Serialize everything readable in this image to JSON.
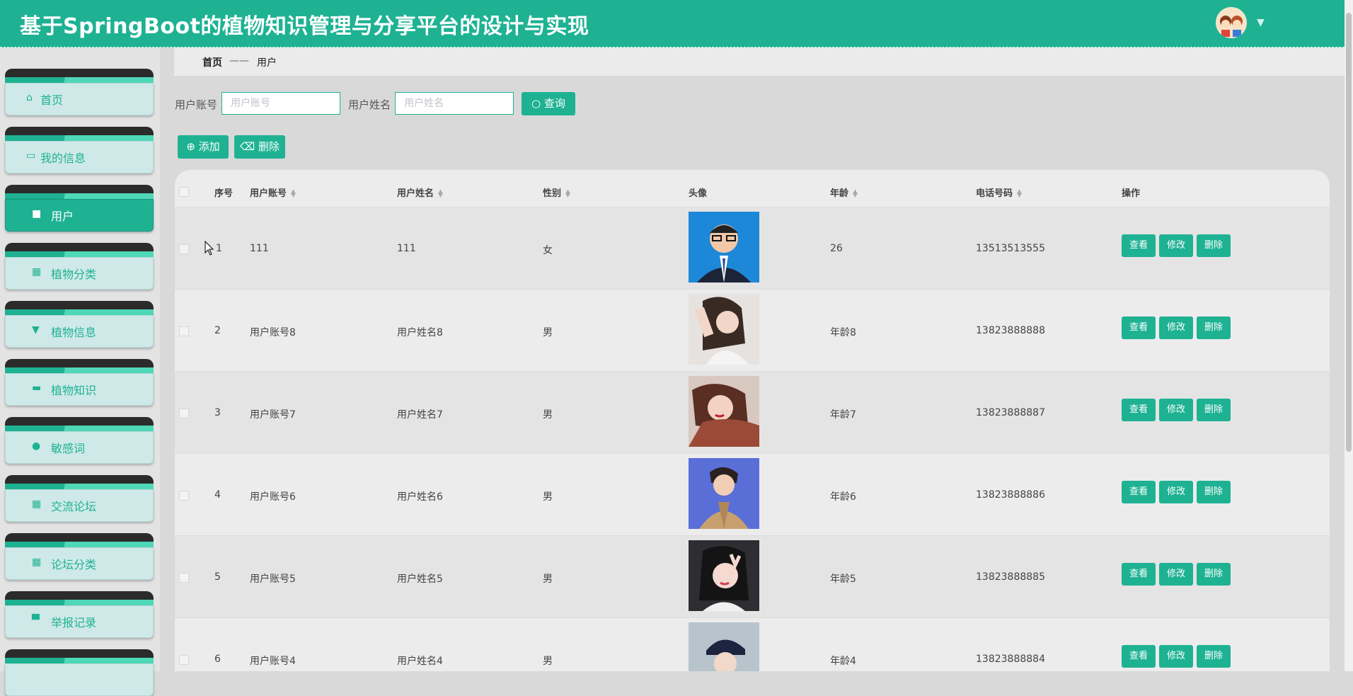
{
  "header": {
    "title": "基于SpringBoot的植物知识管理与分享平台的设计与实现"
  },
  "sidebar": {
    "items": [
      {
        "label": "首页",
        "icon": "home-icon"
      },
      {
        "label": "我的信息",
        "icon": "card-icon"
      },
      {
        "label": "用户",
        "icon": "briefcase-icon",
        "active": true
      },
      {
        "label": "植物分类",
        "icon": "grid-icon"
      },
      {
        "label": "植物信息",
        "icon": "sign-icon"
      },
      {
        "label": "植物知识",
        "icon": "book-icon"
      },
      {
        "label": "敏感词",
        "icon": "pin-icon"
      },
      {
        "label": "交流论坛",
        "icon": "grid-icon"
      },
      {
        "label": "论坛分类",
        "icon": "grid-icon"
      },
      {
        "label": "举报记录",
        "icon": "monitor-icon"
      }
    ]
  },
  "breadcrumb": {
    "home": "首页",
    "sep": "——",
    "current": "用户"
  },
  "search": {
    "account_label": "用户账号",
    "account_placeholder": "用户账号",
    "name_label": "用户姓名",
    "name_placeholder": "用户姓名",
    "query_label": "查询"
  },
  "toolbar": {
    "add_label": "添加",
    "delete_label": "删除"
  },
  "table": {
    "headers": {
      "index": "序号",
      "account": "用户账号",
      "name": "用户姓名",
      "gender": "性别",
      "avatar": "头像",
      "age": "年龄",
      "phone": "电话号码",
      "ops": "操作"
    },
    "actions": {
      "view": "查看",
      "edit": "修改",
      "delete": "删除"
    },
    "rows": [
      {
        "index": "1",
        "account": "111",
        "name": "111",
        "gender": "女",
        "age": "26",
        "phone": "13513513555"
      },
      {
        "index": "2",
        "account": "用户账号8",
        "name": "用户姓名8",
        "gender": "男",
        "age": "年龄8",
        "phone": "13823888888"
      },
      {
        "index": "3",
        "account": "用户账号7",
        "name": "用户姓名7",
        "gender": "男",
        "age": "年龄7",
        "phone": "13823888887"
      },
      {
        "index": "4",
        "account": "用户账号6",
        "name": "用户姓名6",
        "gender": "男",
        "age": "年龄6",
        "phone": "13823888886"
      },
      {
        "index": "5",
        "account": "用户账号5",
        "name": "用户姓名5",
        "gender": "男",
        "age": "年龄5",
        "phone": "13823888885"
      },
      {
        "index": "6",
        "account": "用户账号4",
        "name": "用户姓名4",
        "gender": "男",
        "age": "年龄4",
        "phone": "13823888884"
      }
    ]
  },
  "colors": {
    "accent": "#1eb293",
    "dark": "#2b2b2b",
    "menu_bg": "#cfe9e8"
  }
}
